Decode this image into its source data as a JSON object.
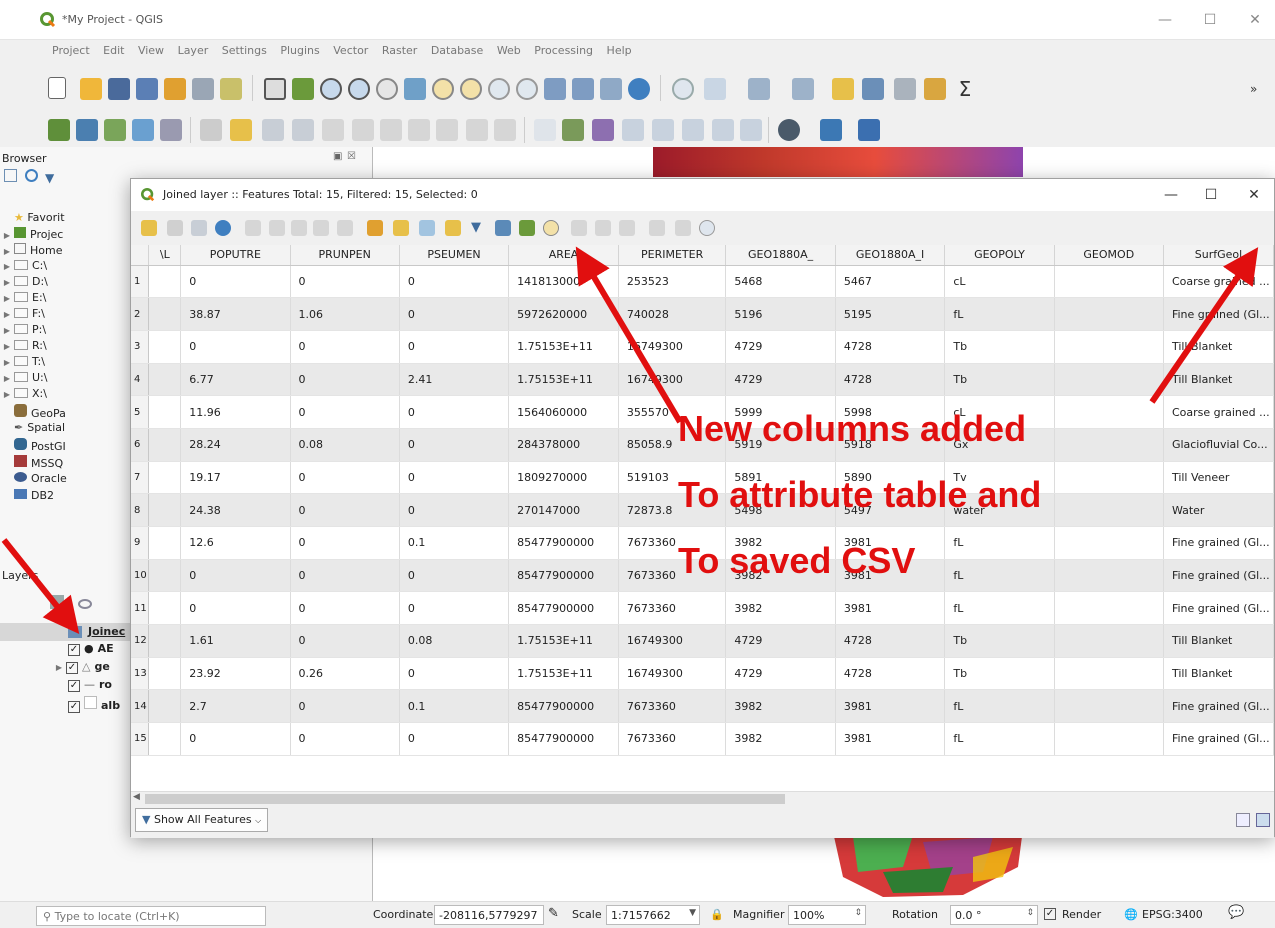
{
  "app": {
    "window_title": "*My Project - QGIS",
    "menu": [
      "Project",
      "Edit",
      "View",
      "Layer",
      "Settings",
      "Plugins",
      "Vector",
      "Raster",
      "Database",
      "Web",
      "Processing",
      "Help"
    ]
  },
  "browser": {
    "title": "Browser",
    "items": [
      "Favorit",
      "Projec",
      "Home",
      "C:\\",
      "D:\\",
      "E:\\",
      "F:\\",
      "P:\\",
      "R:\\",
      "T:\\",
      "U:\\",
      "X:\\",
      "GeoPa",
      "Spatial",
      "PostGI",
      "MSSQ",
      "Oracle",
      "DB2"
    ]
  },
  "layers": {
    "title": "Layers",
    "items": [
      "Joinec",
      "AE",
      "ge",
      "ro",
      "alb"
    ]
  },
  "attr": {
    "title": "Joined layer :: Features Total: 15, Filtered: 15, Selected: 0",
    "columns": [
      "\\L",
      "POPUTRE",
      "PRUNPEN",
      "PSEUMEN",
      "AREA",
      "PERIMETER",
      "GEO1880A_",
      "GEO1880A_I",
      "GEOPOLY",
      "GEOMOD",
      "SurfGeol"
    ],
    "rows": [
      [
        "1",
        "0",
        "0",
        "0",
        "141813000",
        "253523",
        "5468",
        "5467",
        "cL",
        "",
        "Coarse grained ..."
      ],
      [
        "2",
        "38.87",
        "1.06",
        "0",
        "5972620000",
        "740028",
        "5196",
        "5195",
        "fL",
        "",
        "Fine grained (Gl..."
      ],
      [
        "3",
        "0",
        "0",
        "0",
        "1.75153E+11",
        "16749300",
        "4729",
        "4728",
        "Tb",
        "",
        "Till Blanket"
      ],
      [
        "4",
        "6.77",
        "0",
        "2.41",
        "1.75153E+11",
        "16749300",
        "4729",
        "4728",
        "Tb",
        "",
        "Till Blanket"
      ],
      [
        "5",
        "11.96",
        "0",
        "0",
        "1564060000",
        "355570",
        "5999",
        "5998",
        "cL",
        "",
        "Coarse grained ..."
      ],
      [
        "6",
        "28.24",
        "0.08",
        "0",
        "284378000",
        "85058.9",
        "5919",
        "5918",
        "Gx",
        "",
        "Glaciofluvial Co..."
      ],
      [
        "7",
        "19.17",
        "0",
        "0",
        "1809270000",
        "519103",
        "5891",
        "5890",
        "Tv",
        "",
        "Till Veneer"
      ],
      [
        "8",
        "24.38",
        "0",
        "0",
        "270147000",
        "72873.8",
        "5498",
        "5497",
        "water",
        "",
        "Water"
      ],
      [
        "9",
        "12.6",
        "0",
        "0.1",
        "85477900000",
        "7673360",
        "3982",
        "3981",
        "fL",
        "",
        "Fine grained (Gl..."
      ],
      [
        "10",
        "0",
        "0",
        "0",
        "85477900000",
        "7673360",
        "3982",
        "3981",
        "fL",
        "",
        "Fine grained (Gl..."
      ],
      [
        "11",
        "0",
        "0",
        "0",
        "85477900000",
        "7673360",
        "3982",
        "3981",
        "fL",
        "",
        "Fine grained (Gl..."
      ],
      [
        "12",
        "1.61",
        "0",
        "0.08",
        "1.75153E+11",
        "16749300",
        "4729",
        "4728",
        "Tb",
        "",
        "Till Blanket"
      ],
      [
        "13",
        "23.92",
        "0.26",
        "0",
        "1.75153E+11",
        "16749300",
        "4729",
        "4728",
        "Tb",
        "",
        "Till Blanket"
      ],
      [
        "14",
        "2.7",
        "0",
        "0.1",
        "85477900000",
        "7673360",
        "3982",
        "3981",
        "fL",
        "",
        "Fine grained (Gl..."
      ],
      [
        "15",
        "0",
        "0",
        "0",
        "85477900000",
        "7673360",
        "3982",
        "3981",
        "fL",
        "",
        "Fine grained (Gl..."
      ]
    ],
    "show_all": "Show All Features"
  },
  "annotation": {
    "line1": "New columns added",
    "line2": "To attribute table and",
    "line3": "To saved CSV",
    "color": "#e10f0f"
  },
  "status": {
    "locate_placeholder": "Type to locate (Ctrl+K)",
    "coordinate_label": "Coordinate",
    "coordinate_value": "-208116,5779297",
    "scale_label": "Scale",
    "scale_value": "1:7157662",
    "magnifier_label": "Magnifier",
    "magnifier_value": "100%",
    "rotation_label": "Rotation",
    "rotation_value": "0.0 °",
    "render_label": "Render",
    "crs": "EPSG:3400"
  }
}
